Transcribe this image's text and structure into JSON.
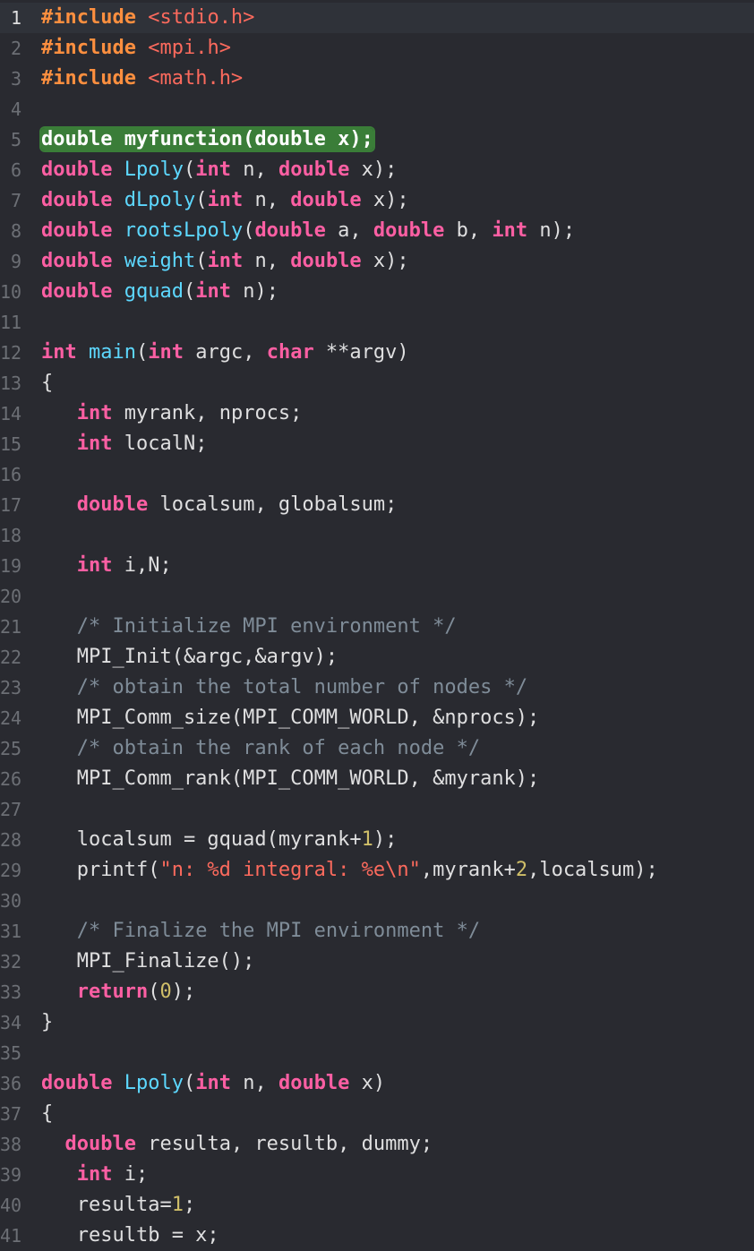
{
  "editor": {
    "current_line": 1,
    "highlight_line": 5,
    "colors": {
      "background": "#292a30",
      "current_line": "#2f3239",
      "gutter_text": "#6c6f75",
      "highlight_bg": "#3a7d38",
      "plain": "#dfdfe0",
      "keyword": "#fc5fa3",
      "preprocessor": "#fd8f3f",
      "function": "#5dd8ff",
      "comment": "#7f8c98",
      "string": "#fc6a5d",
      "number": "#d0bf69"
    },
    "lines": [
      {
        "n": "1",
        "tokens": [
          [
            "#include ",
            "pp"
          ],
          [
            "<stdio.h>",
            "str"
          ]
        ]
      },
      {
        "n": "2",
        "tokens": [
          [
            "#include ",
            "pp"
          ],
          [
            "<mpi.h>",
            "str"
          ]
        ]
      },
      {
        "n": "3",
        "tokens": [
          [
            "#include ",
            "pp"
          ],
          [
            "<math.h>",
            "str"
          ]
        ]
      },
      {
        "n": "4",
        "tokens": []
      },
      {
        "n": "5",
        "tokens": [
          [
            "double myfunction(double x);",
            "hl"
          ]
        ]
      },
      {
        "n": "6",
        "tokens": [
          [
            "double",
            "kw"
          ],
          [
            " ",
            "p"
          ],
          [
            "Lpoly",
            "fn"
          ],
          [
            "(",
            "p"
          ],
          [
            "int",
            "kw"
          ],
          [
            " n, ",
            "p"
          ],
          [
            "double",
            "kw"
          ],
          [
            " x);",
            "p"
          ]
        ]
      },
      {
        "n": "7",
        "tokens": [
          [
            "double",
            "kw"
          ],
          [
            " ",
            "p"
          ],
          [
            "dLpoly",
            "fn"
          ],
          [
            "(",
            "p"
          ],
          [
            "int",
            "kw"
          ],
          [
            " n, ",
            "p"
          ],
          [
            "double",
            "kw"
          ],
          [
            " x);",
            "p"
          ]
        ]
      },
      {
        "n": "8",
        "tokens": [
          [
            "double",
            "kw"
          ],
          [
            " ",
            "p"
          ],
          [
            "rootsLpoly",
            "fn"
          ],
          [
            "(",
            "p"
          ],
          [
            "double",
            "kw"
          ],
          [
            " a, ",
            "p"
          ],
          [
            "double",
            "kw"
          ],
          [
            " b, ",
            "p"
          ],
          [
            "int",
            "kw"
          ],
          [
            " n);",
            "p"
          ]
        ]
      },
      {
        "n": "9",
        "tokens": [
          [
            "double",
            "kw"
          ],
          [
            " ",
            "p"
          ],
          [
            "weight",
            "fn"
          ],
          [
            "(",
            "p"
          ],
          [
            "int",
            "kw"
          ],
          [
            " n, ",
            "p"
          ],
          [
            "double",
            "kw"
          ],
          [
            " x);",
            "p"
          ]
        ]
      },
      {
        "n": "10",
        "tokens": [
          [
            "double",
            "kw"
          ],
          [
            " ",
            "p"
          ],
          [
            "gquad",
            "fn"
          ],
          [
            "(",
            "p"
          ],
          [
            "int",
            "kw"
          ],
          [
            " n);",
            "p"
          ]
        ]
      },
      {
        "n": "11",
        "tokens": []
      },
      {
        "n": "12",
        "tokens": [
          [
            "int",
            "kw"
          ],
          [
            " ",
            "p"
          ],
          [
            "main",
            "fn"
          ],
          [
            "(",
            "p"
          ],
          [
            "int",
            "kw"
          ],
          [
            " argc, ",
            "p"
          ],
          [
            "char",
            "kw"
          ],
          [
            " **argv)",
            "p"
          ]
        ]
      },
      {
        "n": "13",
        "tokens": [
          [
            "{",
            "p"
          ]
        ]
      },
      {
        "n": "14",
        "tokens": [
          [
            "   ",
            "p"
          ],
          [
            "int",
            "kw"
          ],
          [
            " myrank, nprocs;",
            "p"
          ]
        ]
      },
      {
        "n": "15",
        "tokens": [
          [
            "   ",
            "p"
          ],
          [
            "int",
            "kw"
          ],
          [
            " localN;",
            "p"
          ]
        ]
      },
      {
        "n": "16",
        "tokens": []
      },
      {
        "n": "17",
        "tokens": [
          [
            "   ",
            "p"
          ],
          [
            "double",
            "kw"
          ],
          [
            " localsum, globalsum;",
            "p"
          ]
        ]
      },
      {
        "n": "18",
        "tokens": []
      },
      {
        "n": "19",
        "tokens": [
          [
            "   ",
            "p"
          ],
          [
            "int",
            "kw"
          ],
          [
            " i,N;",
            "p"
          ]
        ]
      },
      {
        "n": "20",
        "tokens": []
      },
      {
        "n": "21",
        "tokens": [
          [
            "   ",
            "p"
          ],
          [
            "/* Initialize MPI environment */",
            "cm"
          ]
        ]
      },
      {
        "n": "22",
        "tokens": [
          [
            "   MPI_Init(&argc,&argv);",
            "p"
          ]
        ]
      },
      {
        "n": "23",
        "tokens": [
          [
            "   ",
            "p"
          ],
          [
            "/* obtain the total number of nodes */",
            "cm"
          ]
        ]
      },
      {
        "n": "24",
        "tokens": [
          [
            "   MPI_Comm_size(MPI_COMM_WORLD, &nprocs);",
            "p"
          ]
        ]
      },
      {
        "n": "25",
        "tokens": [
          [
            "   ",
            "p"
          ],
          [
            "/* obtain the rank of each node */",
            "cm"
          ]
        ]
      },
      {
        "n": "26",
        "tokens": [
          [
            "   MPI_Comm_rank(MPI_COMM_WORLD, &myrank);",
            "p"
          ]
        ]
      },
      {
        "n": "27",
        "tokens": []
      },
      {
        "n": "28",
        "tokens": [
          [
            "   localsum = gquad(myrank+",
            "p"
          ],
          [
            "1",
            "num"
          ],
          [
            ");",
            "p"
          ]
        ]
      },
      {
        "n": "29",
        "tokens": [
          [
            "   printf(",
            "p"
          ],
          [
            "\"n: %d integral: %e\\n\"",
            "str"
          ],
          [
            ",myrank+",
            "p"
          ],
          [
            "2",
            "num"
          ],
          [
            ",localsum);",
            "p"
          ]
        ]
      },
      {
        "n": "30",
        "tokens": []
      },
      {
        "n": "31",
        "tokens": [
          [
            "   ",
            "p"
          ],
          [
            "/* Finalize the MPI environment */",
            "cm"
          ]
        ]
      },
      {
        "n": "32",
        "tokens": [
          [
            "   MPI_Finalize();",
            "p"
          ]
        ]
      },
      {
        "n": "33",
        "tokens": [
          [
            "   ",
            "p"
          ],
          [
            "return",
            "kw"
          ],
          [
            "(",
            "p"
          ],
          [
            "0",
            "num"
          ],
          [
            ");",
            "p"
          ]
        ]
      },
      {
        "n": "34",
        "tokens": [
          [
            "}",
            "p"
          ]
        ]
      },
      {
        "n": "35",
        "tokens": []
      },
      {
        "n": "36",
        "tokens": [
          [
            "double",
            "kw"
          ],
          [
            " ",
            "p"
          ],
          [
            "Lpoly",
            "fn"
          ],
          [
            "(",
            "p"
          ],
          [
            "int",
            "kw"
          ],
          [
            " n, ",
            "p"
          ],
          [
            "double",
            "kw"
          ],
          [
            " x)",
            "p"
          ]
        ]
      },
      {
        "n": "37",
        "tokens": [
          [
            "{",
            "p"
          ]
        ]
      },
      {
        "n": "38",
        "tokens": [
          [
            "  ",
            "p"
          ],
          [
            "double",
            "kw"
          ],
          [
            " resulta, resultb, dummy;",
            "p"
          ]
        ]
      },
      {
        "n": "39",
        "tokens": [
          [
            "   ",
            "p"
          ],
          [
            "int",
            "kw"
          ],
          [
            " i;",
            "p"
          ]
        ]
      },
      {
        "n": "40",
        "tokens": [
          [
            "   resulta=",
            "p"
          ],
          [
            "1",
            "num"
          ],
          [
            ";",
            "p"
          ]
        ]
      },
      {
        "n": "41",
        "tokens": [
          [
            "   resultb = x;",
            "p"
          ]
        ]
      }
    ]
  }
}
